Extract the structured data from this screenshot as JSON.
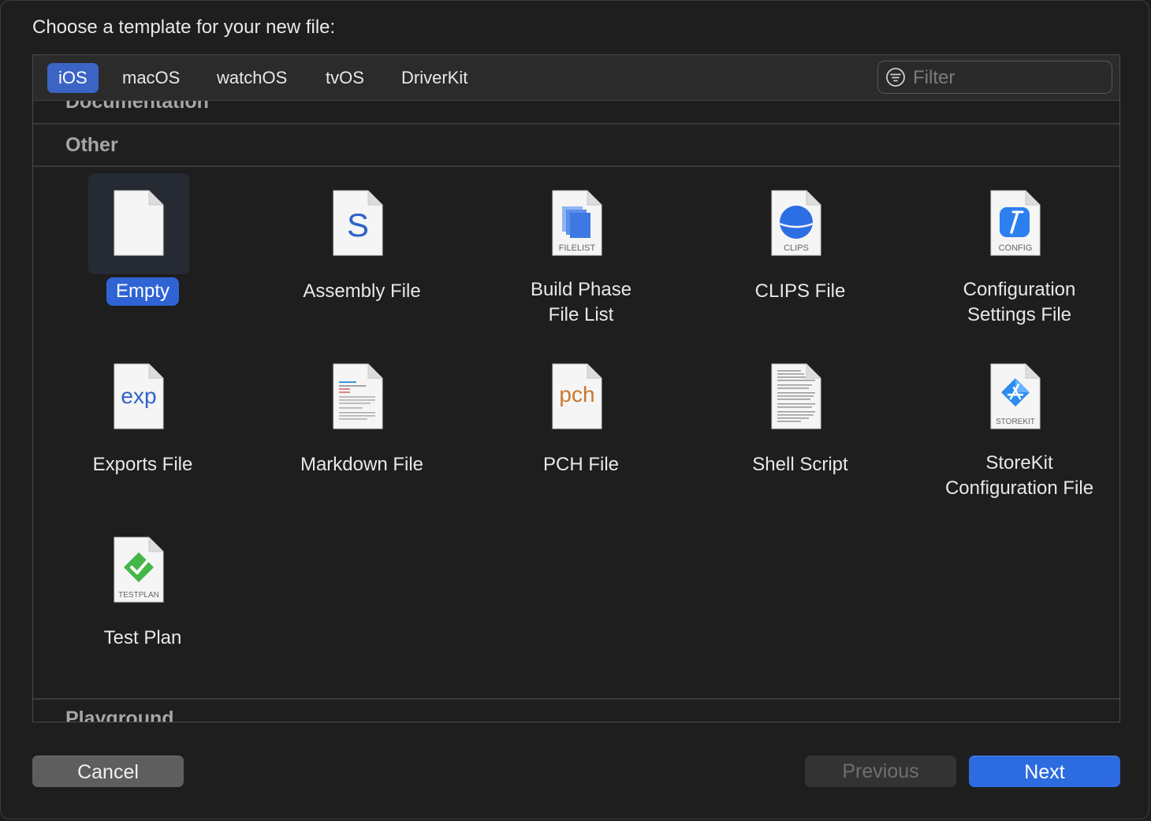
{
  "dialog": {
    "prompt": "Choose a template for your new file:"
  },
  "tabs": [
    {
      "label": "iOS",
      "active": true
    },
    {
      "label": "macOS",
      "active": false
    },
    {
      "label": "watchOS",
      "active": false
    },
    {
      "label": "tvOS",
      "active": false
    },
    {
      "label": "DriverKit",
      "active": false
    }
  ],
  "filter": {
    "placeholder": "Filter",
    "value": ""
  },
  "sections": {
    "documentation": "Documentation",
    "other": "Other",
    "playground": "Playground"
  },
  "templates": [
    {
      "label": "Empty",
      "icon": "empty-file-icon",
      "selected": true
    },
    {
      "label": "Assembly File",
      "icon": "assembly-file-icon",
      "badge": "S"
    },
    {
      "label": "Build Phase File List",
      "line1": "Build Phase",
      "line2": "File List",
      "icon": "filelist-icon",
      "badge": "FILELIST"
    },
    {
      "label": "CLIPS File",
      "icon": "clips-icon",
      "badge": "CLIPS"
    },
    {
      "label": "Configuration Settings File",
      "line1": "Configuration",
      "line2": "Settings File",
      "icon": "config-icon",
      "badge": "CONFIG"
    },
    {
      "label": "Exports File",
      "icon": "exports-file-icon",
      "badge": "exp"
    },
    {
      "label": "Markdown File",
      "icon": "markdown-file-icon"
    },
    {
      "label": "PCH File",
      "icon": "pch-file-icon",
      "badge": "pch"
    },
    {
      "label": "Shell Script",
      "icon": "shell-script-icon"
    },
    {
      "label": "StoreKit Configuration File",
      "line1": "StoreKit",
      "line2": "Configuration File",
      "icon": "storekit-icon",
      "badge": "STOREKIT"
    },
    {
      "label": "Test Plan",
      "icon": "testplan-icon",
      "badge": "TESTPLAN"
    }
  ],
  "buttons": {
    "cancel": "Cancel",
    "previous": "Previous",
    "next": "Next",
    "previous_enabled": false
  },
  "colors": {
    "accent": "#2d6be0",
    "selection": "#3064d4",
    "background": "#1e1e1e",
    "assembly_s": "#2f63c9",
    "exp_text": "#2f63c9",
    "pch_text": "#c9782c",
    "testplan_green": "#45b649",
    "storekit_blue": "#2c8cf0"
  }
}
